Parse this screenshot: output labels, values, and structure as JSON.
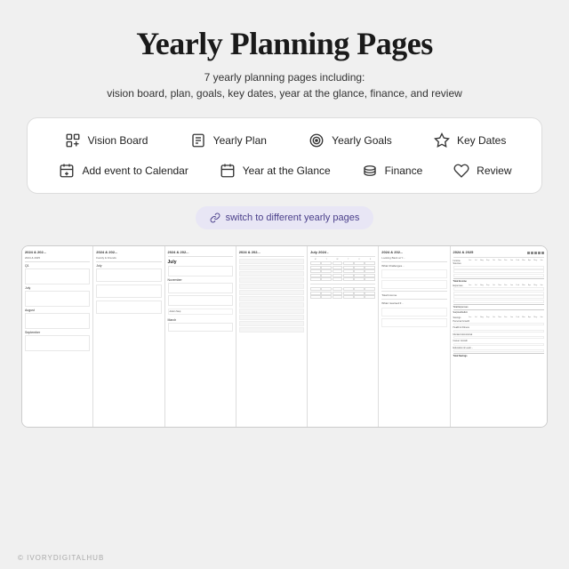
{
  "header": {
    "title": "Yearly Planning Pages",
    "subtitle_line1": "7 yearly planning pages including:",
    "subtitle_line2": "vision board, plan, goals, key dates, year at the glance, finance, and review"
  },
  "nav": {
    "row1": [
      {
        "label": "Vision Board",
        "icon": "vision-board-icon"
      },
      {
        "label": "Yearly Plan",
        "icon": "yearly-plan-icon"
      },
      {
        "label": "Yearly Goals",
        "icon": "yearly-goals-icon"
      },
      {
        "label": "Key Dates",
        "icon": "key-dates-icon"
      }
    ],
    "row2": [
      {
        "label": "Add event to Calendar",
        "icon": "add-calendar-icon"
      },
      {
        "label": "Year at the Glance",
        "icon": "year-glance-icon"
      },
      {
        "label": "Finance",
        "icon": "finance-icon"
      },
      {
        "label": "Review",
        "icon": "review-icon"
      }
    ]
  },
  "switch_btn": {
    "label": "switch to different yearly pages",
    "icon": "link-icon"
  },
  "preview": {
    "pages": [
      {
        "id": "vision-board",
        "header": "2024 & 202...",
        "subheader": "2024 & 2025",
        "label": "Q1"
      },
      {
        "id": "yearly-plan",
        "header": "2024 & 202...",
        "subheader": "Family & Friends",
        "label": "July"
      },
      {
        "id": "yearly-goals",
        "header": "2024 & 202...",
        "subheader": "July",
        "label": "November"
      },
      {
        "id": "key-dates",
        "header": "2024 & 202...",
        "subheader": "",
        "label": ""
      },
      {
        "id": "year-glance",
        "header": "July 2024 -",
        "subheader": "",
        "label": ""
      },
      {
        "id": "review",
        "header": "2024 & 202...",
        "subheader": "Looking Back at Y...",
        "label": "What Challenges..."
      },
      {
        "id": "finance",
        "header": "2024 & 2025",
        "subheader": "Income Sources",
        "month_cols": [
          "Jun",
          "Jul",
          "Aug",
          "Sep",
          "Oct",
          "Nov",
          "Dec",
          "Jan",
          "Feb",
          "Mar",
          "Apr",
          "May",
          "Jun"
        ],
        "sections": [
          "Total Income",
          "Expenses",
          "Total Expenses",
          "Surplus/Deficit",
          "Savings",
          "Total Savings"
        ]
      }
    ]
  },
  "brand": "© IVORYDIGITALHUB"
}
